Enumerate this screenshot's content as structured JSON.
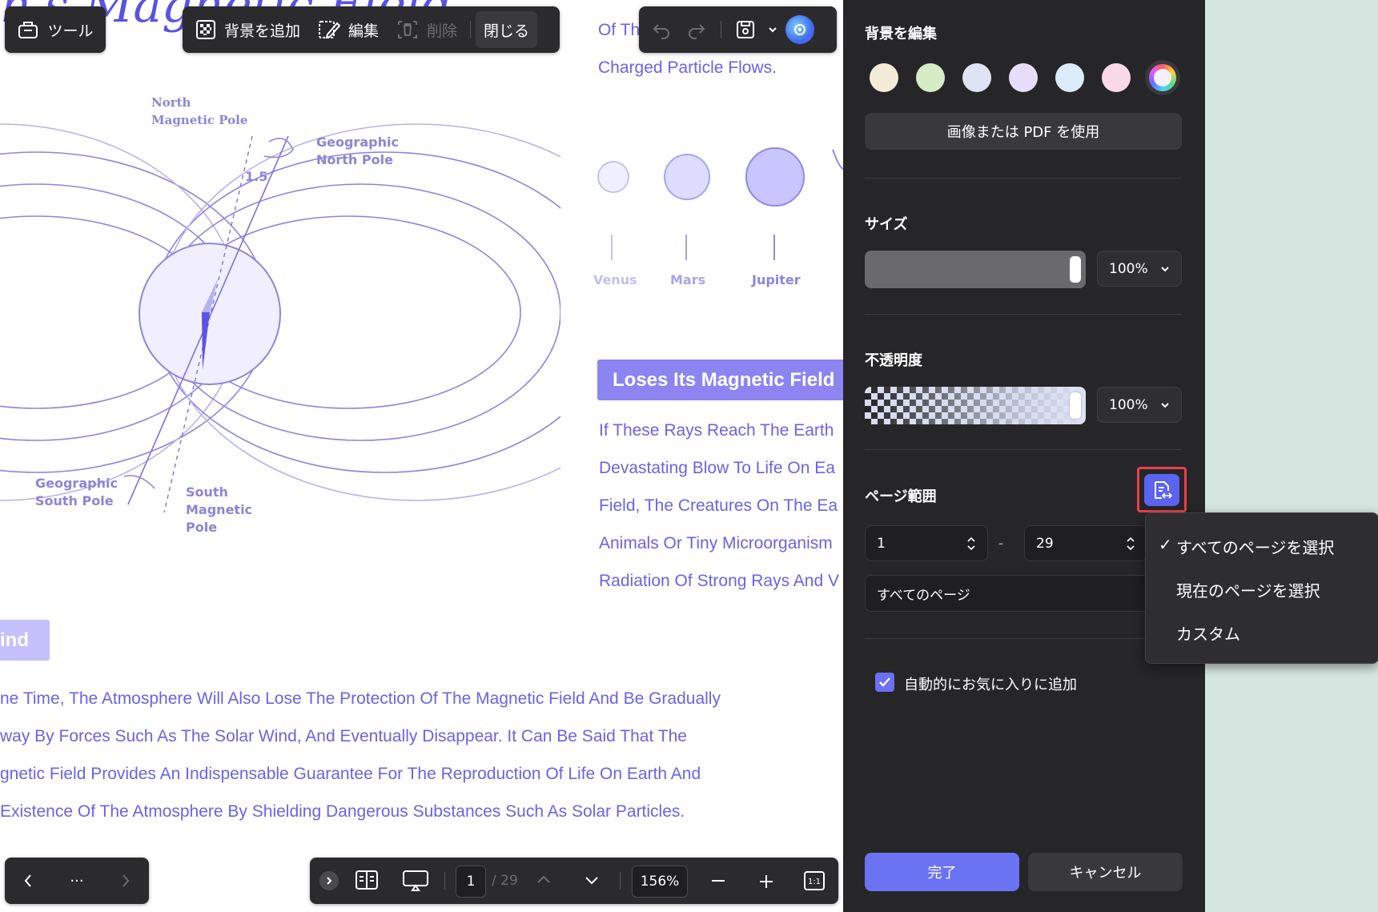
{
  "document": {
    "top_right_title_fragment": "Of Th",
    "title_line2": "Charged Particle Flows.",
    "diagram": {
      "north_magnetic_pole": [
        "North",
        "Magnetic Pole"
      ],
      "geographic_north_pole": [
        "Geographic",
        "North Pole"
      ],
      "angle": "1.5",
      "geographic_south_pole": [
        "Geographic",
        "South Pole"
      ],
      "south_magnetic_pole": [
        "South",
        "Magnetic",
        "Pole"
      ]
    },
    "planets": [
      "Venus",
      "Mars",
      "Jupiter"
    ],
    "section_heading": "Loses Its Magnetic Field",
    "right_paragraph": [
      "If These Rays Reach The Earth",
      "Devastating Blow To Life On Ea",
      "Field, The Creatures On The Ea",
      "Animals Or Tiny Microorganism",
      "Radiation Of Strong Rays And V"
    ],
    "left_heading_fragment": "ind",
    "bottom_paragraph": [
      "ne Time, The Atmosphere Will Also Lose The Protection Of The Magnetic Field And Be Gradually",
      "way By Forces Such As The Solar Wind, And Eventually Disappear. It Can Be Said That The",
      "gnetic Field Provides An Indispensable Guarantee For The Reproduction Of Life On Earth And",
      " Existence Of The Atmosphere By Shielding Dangerous Substances Such As Solar Particles."
    ]
  },
  "toolbar": {
    "tools_label": "ツール",
    "add_background_label": "背景を追加",
    "edit_label": "編集",
    "delete_label": "削除",
    "close_label": "閉じる"
  },
  "bottom_bar": {
    "more_label": "···",
    "current_page": "1",
    "total_pages": "/ 29",
    "zoom": "156%"
  },
  "panel": {
    "title": "背景を編集",
    "colors": [
      "#f4ead8",
      "#d6ecc5",
      "#dfe3f3",
      "#e6ddf8",
      "#dcebfa",
      "#fbd9e6"
    ],
    "use_image_pdf_label": "画像または PDF を使用",
    "size_label": "サイズ",
    "size_value": "100%",
    "size_level": 1.0,
    "opacity_label": "不透明度",
    "opacity_value": "100%",
    "opacity_level": 1.0,
    "page_range_label": "ページ範囲",
    "range_from": "1",
    "range_separator": "-",
    "range_to": "29",
    "page_select_value": "すべてのページ",
    "auto_favorite_label": "自動的にお気に入りに追加",
    "auto_favorite_checked": true,
    "done_label": "完了",
    "cancel_label": "キャンセル"
  },
  "page_range_menu": {
    "checkmark": "✓",
    "items": [
      "すべてのページを選択",
      "現在のページを選択",
      "カスタム"
    ],
    "selected_index": 0
  }
}
